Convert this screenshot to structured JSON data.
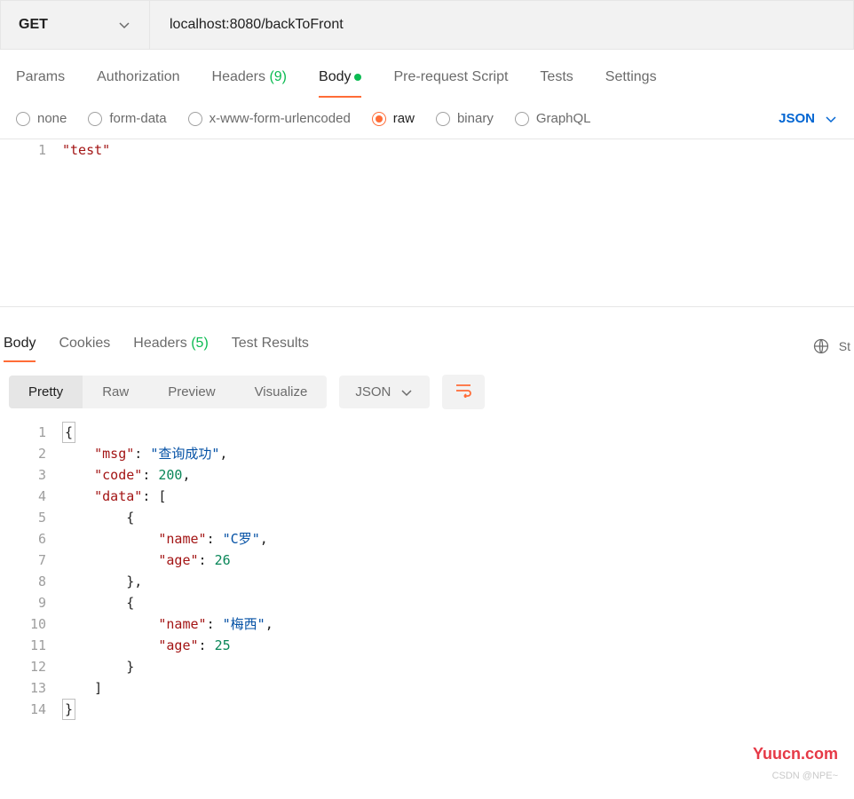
{
  "request": {
    "method": "GET",
    "url": "localhost:8080/backToFront"
  },
  "tabs": {
    "params": "Params",
    "authorization": "Authorization",
    "headers": "Headers",
    "headers_count": "(9)",
    "body": "Body",
    "prerequest": "Pre-request Script",
    "tests": "Tests",
    "settings": "Settings"
  },
  "body_types": {
    "none": "none",
    "form_data": "form-data",
    "url_encoded": "x-www-form-urlencoded",
    "raw": "raw",
    "binary": "binary",
    "graphql": "GraphQL"
  },
  "body_lang": "JSON",
  "request_body": {
    "line1": "\"test\""
  },
  "response_tabs": {
    "body": "Body",
    "cookies": "Cookies",
    "headers": "Headers",
    "headers_count": "(5)",
    "test_results": "Test Results",
    "status_prefix": "St"
  },
  "view_modes": {
    "pretty": "Pretty",
    "raw": "Raw",
    "preview": "Preview",
    "visualize": "Visualize"
  },
  "response_lang": "JSON",
  "response": {
    "msg": "查询成功",
    "code": 200,
    "data": [
      {
        "name": "C罗",
        "age": 26
      },
      {
        "name": "梅西",
        "age": 25
      }
    ]
  },
  "watermark": "Yuucn.com",
  "watermark2": "CSDN @NPE~"
}
